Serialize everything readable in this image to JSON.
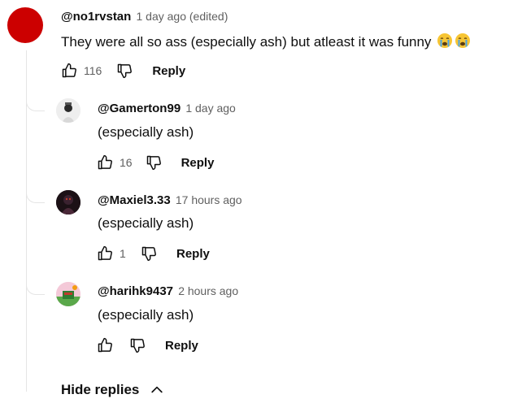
{
  "main_comment": {
    "author": "@no1rvstan",
    "time": "1 day ago (edited)",
    "text": "They were all so ass (especially ash) but atleast it was funny",
    "emoji": [
      "crying-face-emoji",
      "crying-face-emoji"
    ],
    "likes": "116",
    "reply_label": "Reply",
    "avatar_color": "#cc0000"
  },
  "replies": [
    {
      "author": "@Gamerton99",
      "time": "1 day ago",
      "text": "(especially ash)",
      "likes": "16",
      "reply_label": "Reply"
    },
    {
      "author": "@Maxiel3.33",
      "time": "17 hours ago",
      "text": "(especially ash)",
      "likes": "1",
      "reply_label": "Reply"
    },
    {
      "author": "@harihk9437",
      "time": "2 hours ago",
      "text": "(especially ash)",
      "likes": "",
      "reply_label": "Reply"
    }
  ],
  "hide_replies_label": "Hide replies"
}
